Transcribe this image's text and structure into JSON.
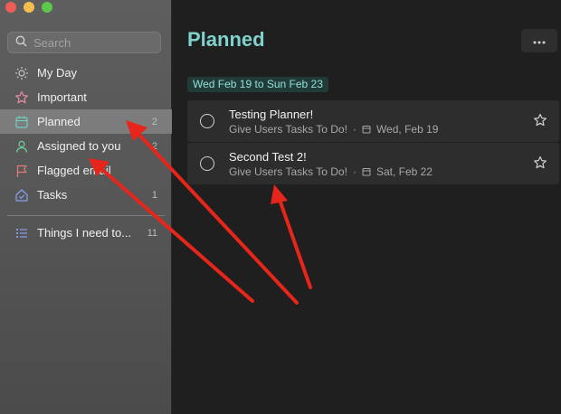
{
  "window": {
    "traffic_lights": [
      "close",
      "minimize",
      "zoom"
    ]
  },
  "search": {
    "placeholder": "Search",
    "icon": "search-icon"
  },
  "sidebar": {
    "items": [
      {
        "label": "My Day",
        "count": "",
        "icon": "sun-icon",
        "color": "#bdbdbd"
      },
      {
        "label": "Important",
        "count": "",
        "icon": "star-icon",
        "color": "#e78fa2"
      },
      {
        "label": "Planned",
        "count": "2",
        "icon": "calendar-icon",
        "color": "#6fd0c4",
        "active": true
      },
      {
        "label": "Assigned to you",
        "count": "2",
        "icon": "person-icon",
        "color": "#6fd0a0"
      },
      {
        "label": "Flagged email",
        "count": "",
        "icon": "flag-icon",
        "color": "#e07a7a"
      },
      {
        "label": "Tasks",
        "count": "1",
        "icon": "home-icon",
        "color": "#8aa0f0"
      }
    ],
    "lists": [
      {
        "label": "Things I need to...",
        "count": "11",
        "icon": "list-icon",
        "color": "#8aa0f0"
      }
    ]
  },
  "main": {
    "title": "Planned",
    "more_icon": "more-icon",
    "date_range": "Wed Feb 19 to Sun Feb 23",
    "tasks": [
      {
        "title": "Testing Planner!",
        "list": "Give Users Tasks To Do!",
        "separator": "·",
        "due": "Wed, Feb 19"
      },
      {
        "title": "Second Test 2!",
        "list": "Give Users Tasks To Do!",
        "separator": "·",
        "due": "Sat, Feb 22"
      }
    ]
  },
  "annotations": {
    "arrow_color": "#e8251a",
    "arrow_count": 3
  },
  "colors": {
    "accent": "#7fd3cc",
    "sidebar_active": "#7c7c7c",
    "task_bg": "#2d2d2d"
  }
}
